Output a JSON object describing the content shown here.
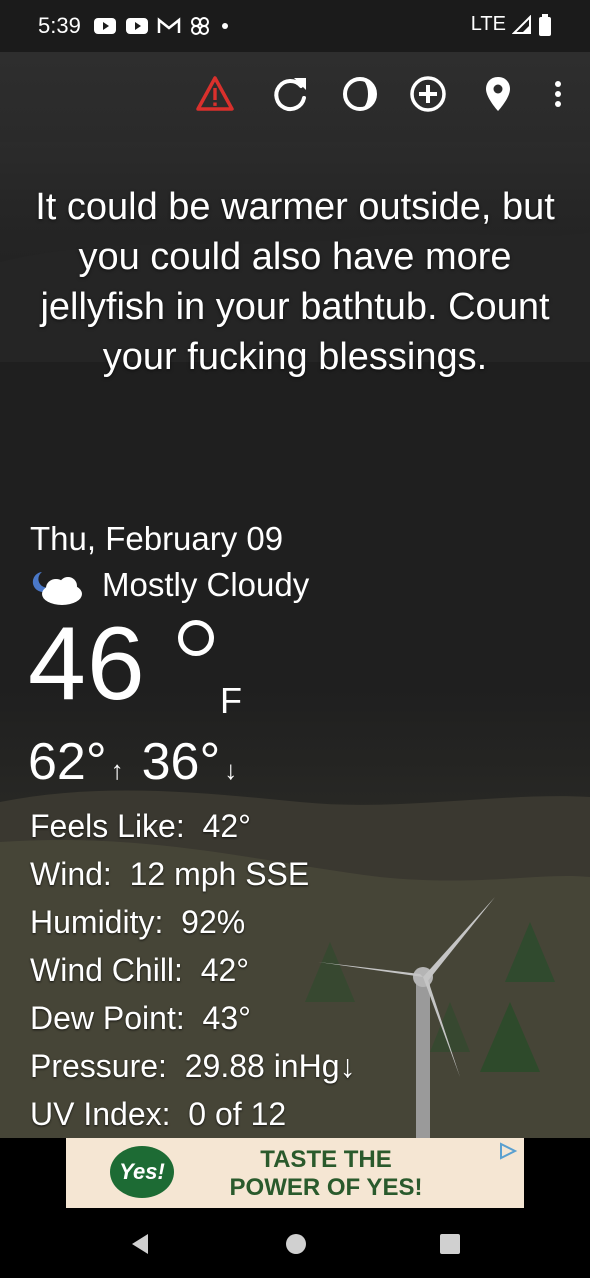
{
  "status_bar": {
    "time": "5:39",
    "network": "LTE",
    "icons": [
      "youtube-icon",
      "youtube-icon",
      "gmail-icon",
      "pinwheel-icon",
      "dot-icon"
    ]
  },
  "toolbar": {
    "icons": [
      "warning-icon",
      "refresh-icon",
      "theme-icon",
      "add-location-icon",
      "location-pin-icon",
      "more-vert-icon"
    ],
    "warning_color": "#d9302c"
  },
  "message": "It could be warmer outside, but you could also have more jellyfish in your bathtub. Count your fucking blessings.",
  "weather": {
    "date": "Thu, February 09",
    "condition": "Mostly Cloudy",
    "condition_icon": "partly-cloudy-night-icon",
    "temperature": "46",
    "unit": "F",
    "high": "62°",
    "low": "36°",
    "details": [
      {
        "label": "Feels Like:",
        "value": "42°"
      },
      {
        "label": "Wind:",
        "value": "12 mph SSE"
      },
      {
        "label": "Humidity:",
        "value": "92%"
      },
      {
        "label": "Wind Chill:",
        "value": "42°"
      },
      {
        "label": "Dew Point:",
        "value": "43°"
      },
      {
        "label": "Pressure:",
        "value": "29.88 inHg↓"
      },
      {
        "label": "UV Index:",
        "value": "0 of 12"
      }
    ]
  },
  "ad": {
    "logo_text": "Yes!",
    "headline_1": "TASTE THE",
    "headline_2": "POWER OF YES!"
  }
}
